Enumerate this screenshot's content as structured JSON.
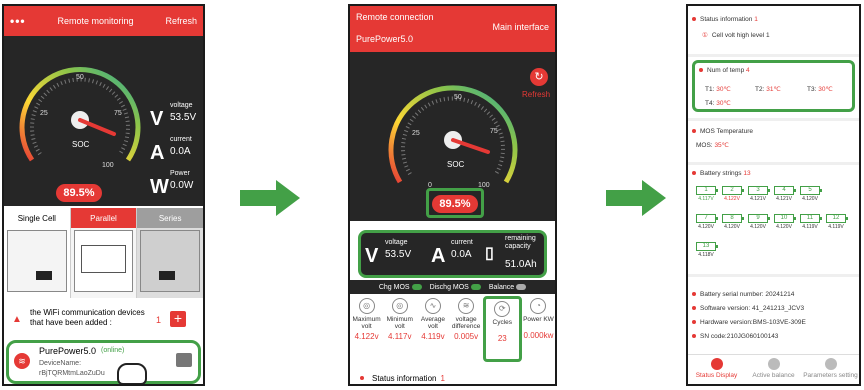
{
  "colors": {
    "accent": "#e53935",
    "highlight": "#43a047",
    "dark": "#262626"
  },
  "p1": {
    "menu_icon": "dots-icon",
    "title": "Remote monitoring",
    "refresh": "Refresh",
    "gauge_ticks": [
      "25",
      "50",
      "75",
      "100",
      "0"
    ],
    "soc_label": "SOC",
    "soc_value": "89.5%",
    "voltage_label": "voltage",
    "voltage_value": "53.5V",
    "current_label": "current",
    "current_value": "0.0A",
    "power_label": "Power",
    "power_value": "0.0W",
    "modes": [
      "Single Cell",
      "Parallel",
      "Series"
    ],
    "wifi_text": "the WiFi communication devices that have been added :",
    "wifi_count": "1",
    "device_name": "PurePower5.0",
    "device_status": "(online)",
    "device_name_label": "DeviceName:",
    "device_id": "rBjTQRMtmLaoZuDu"
  },
  "p2": {
    "connection": "Remote connection",
    "device": "PurePower5.0",
    "main_interface": "Main interface",
    "refresh": "Refresh",
    "gauge_ticks": [
      "25",
      "50",
      "75",
      "100",
      "0"
    ],
    "soc_label": "SOC",
    "soc_value": "89.5%",
    "voltage_label": "voltage",
    "voltage_value": "53.5V",
    "current_label": "current",
    "current_value": "0.0A",
    "capacity_label": "remaining capacity",
    "capacity_value": "51.0Ah",
    "chg_mos": "Chg MOS",
    "dischg_mos": "Dischg MOS",
    "balance": "Balance",
    "stats": [
      {
        "label": "Maximum volt",
        "value": "4.122v"
      },
      {
        "label": "Minimum volt",
        "value": "4.117v"
      },
      {
        "label": "Average volt",
        "value": "4.119v"
      },
      {
        "label": "voltage difference",
        "value": "0.005v"
      },
      {
        "label": "Cycles",
        "value": "23"
      },
      {
        "label": "Power KW",
        "value": "0.000kw"
      }
    ],
    "status_info": "Status information",
    "status_count": "1"
  },
  "p3": {
    "status_info": "Status information",
    "status_count": "1",
    "status_item": "Cell volt high level 1",
    "temp_title": "Num of temp",
    "temp_count": "4",
    "temps": [
      {
        "label": "T1:",
        "value": "30℃"
      },
      {
        "label": "T2:",
        "value": "31℃"
      },
      {
        "label": "T3:",
        "value": "30℃"
      },
      {
        "label": "T4:",
        "value": "30℃"
      }
    ],
    "mos_title": "MOS Temperature",
    "mos_label": "MOS:",
    "mos_value": "35℃",
    "strings_title": "Battery strings",
    "strings_count": "13",
    "cells": [
      {
        "n": "1",
        "v": "4.117V"
      },
      {
        "n": "2",
        "v": "4.122V"
      },
      {
        "n": "3",
        "v": "4.121V"
      },
      {
        "n": "4",
        "v": "4.121V"
      },
      {
        "n": "5",
        "v": "4.120V"
      },
      {
        "n": "7",
        "v": "4.120V"
      },
      {
        "n": "8",
        "v": "4.120V"
      },
      {
        "n": "9",
        "v": "4.120V"
      },
      {
        "n": "10",
        "v": "4.120V"
      },
      {
        "n": "11",
        "v": "4.119V"
      },
      {
        "n": "12",
        "v": "4.119V"
      },
      {
        "n": "13",
        "v": "4.118V"
      }
    ],
    "serial": "Battery serial number:  20241214",
    "software": "Software version:  41_241213_JCV3",
    "hardware": "Hardware version:BMS-103VE-309E",
    "sn_code": "SN code:210JG060100143",
    "nav": [
      "Status Display",
      "Active balance",
      "Parameters setting"
    ]
  }
}
